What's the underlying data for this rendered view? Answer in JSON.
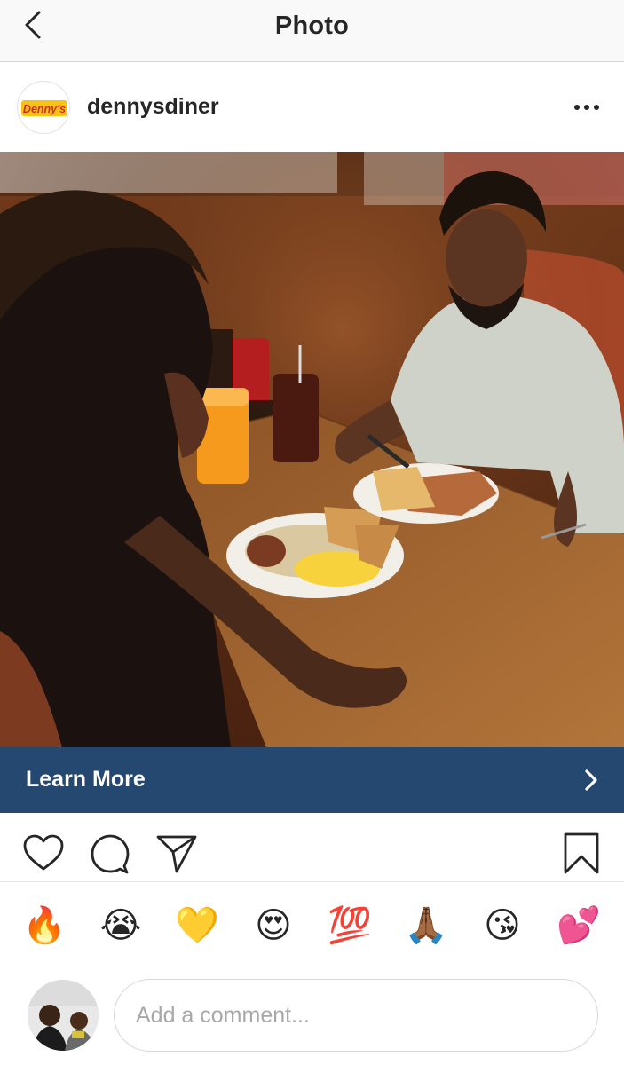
{
  "nav": {
    "title": "Photo",
    "back_icon": "chevron-left-icon"
  },
  "post": {
    "username": "dennysdiner",
    "avatar_logo_text": "Denny's",
    "more_icon": "more-horizontal-icon",
    "photo_alt": "Two people at a diner booth with breakfast plates"
  },
  "cta": {
    "label": "Learn More",
    "icon": "chevron-right-icon",
    "color": "#244870"
  },
  "actions": {
    "icons": [
      "heart-icon",
      "comment-icon",
      "share-icon",
      "bookmark-icon"
    ]
  },
  "emojis": [
    "🔥",
    "😭",
    "💛",
    "😍",
    "💯",
    "🙏🏾",
    "😘",
    "💕"
  ],
  "comment": {
    "placeholder": "Add a comment..."
  }
}
